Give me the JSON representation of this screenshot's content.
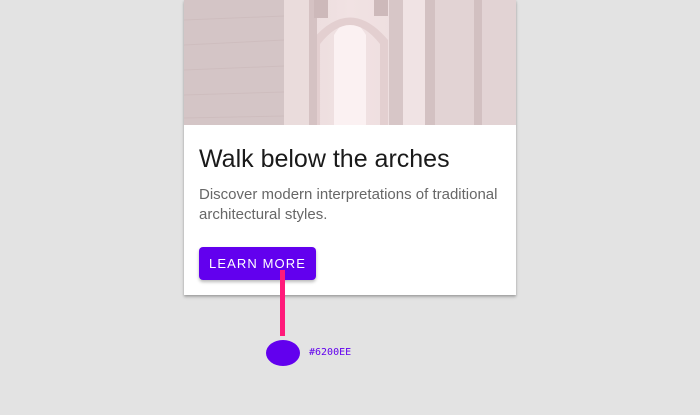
{
  "card": {
    "title": "Walk below the arches",
    "body": "Discover modern interpretations of traditional architectural styles.",
    "button_label": "LEARN MORE"
  },
  "annotation": {
    "color_label": "#6200EE"
  },
  "colors": {
    "primary": "#6200EE",
    "pointer": "#FF1A7A",
    "background": "#E3E3E3"
  }
}
